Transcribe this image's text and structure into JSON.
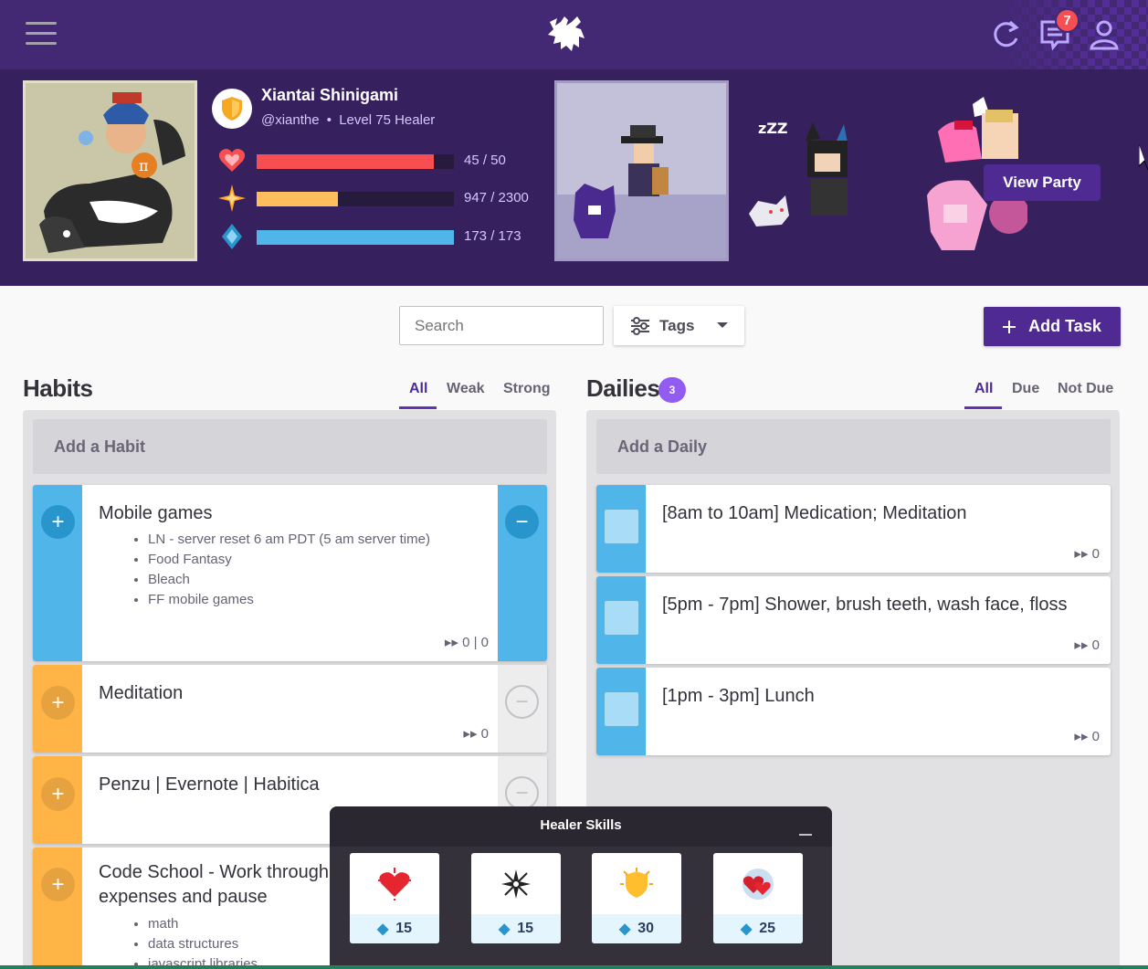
{
  "nav": {
    "menu_icon": "hamburger-menu-icon",
    "logo_icon": "gryphon-logo-icon",
    "sync_icon": "sync-icon",
    "messages_icon": "chat-icon",
    "notification_count": "7",
    "user_icon": "user-icon"
  },
  "profile": {
    "name": "Xiantai Shinigami",
    "handle": "@xianthe",
    "separator": "•",
    "level_class": "Level 75 Healer",
    "health": {
      "label": "45 / 50",
      "fraction": 0.9,
      "color": "#f74e52"
    },
    "experience": {
      "label": "947 / 2300",
      "fraction": 0.41,
      "color": "#ffbe5d"
    },
    "mana": {
      "label": "173 / 173",
      "fraction": 1.0,
      "color": "#50b5e9"
    }
  },
  "party": {
    "button": "View Party",
    "sleep_text": "zZZ"
  },
  "toolbar": {
    "search_placeholder": "Search",
    "tags_label": "Tags",
    "add_task_label": "Add Task"
  },
  "habits": {
    "title": "Habits",
    "filters": [
      "All",
      "Weak",
      "Strong"
    ],
    "add_placeholder": "Add a Habit",
    "items": [
      {
        "title": "Mobile games",
        "notes": [
          "LN - server reset 6 am PDT (5 am server time)",
          "Food Fantasy",
          "Bleach",
          "FF mobile games"
        ],
        "streak": "0 | 0",
        "color": "#50b5e9"
      },
      {
        "title": "Meditation",
        "streak": "0",
        "color": "#ffb445"
      },
      {
        "title": "Penzu | Evernote | Habitica",
        "color": "#ffb445"
      },
      {
        "title_line1": "Code School - Work through m",
        "title_line2": "expenses and pause",
        "notes": [
          "math",
          "data structures",
          "javascript libraries"
        ],
        "color": "#ffb445"
      }
    ]
  },
  "dailies": {
    "title": "Dailies",
    "count": "3",
    "filters": [
      "All",
      "Due",
      "Not Due"
    ],
    "add_placeholder": "Add a Daily",
    "items": [
      {
        "title": "[8am to 10am] Medication; Meditation",
        "streak": "0"
      },
      {
        "title": "[5pm - 7pm] Shower, brush teeth, wash face, floss",
        "streak": "0"
      },
      {
        "title": "[1pm - 3pm] Lunch",
        "streak": "0"
      }
    ]
  },
  "skills": {
    "title": "Healer Skills",
    "items": [
      {
        "icon": "healing-light-icon",
        "cost": "15"
      },
      {
        "icon": "searing-brightness-icon",
        "cost": "15"
      },
      {
        "icon": "protective-aura-icon",
        "cost": "30"
      },
      {
        "icon": "blessing-icon",
        "cost": "25"
      }
    ]
  }
}
